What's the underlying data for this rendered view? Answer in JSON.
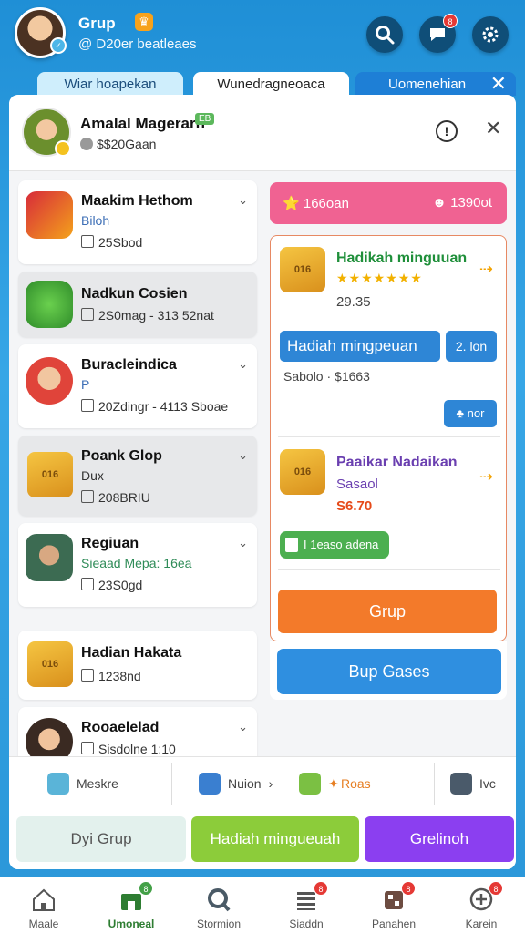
{
  "header": {
    "title": "Grup",
    "subtitle": "@ D20er beatleaes"
  },
  "tabs": [
    {
      "label": "Wiar hoapekan"
    },
    {
      "label": "Wunedragneoaca"
    },
    {
      "label": "Uomenehian"
    }
  ],
  "notification": {
    "name": "Amalal Magerarn",
    "tag": "EB",
    "sub": "$$20Gaan"
  },
  "list": [
    {
      "title": "Maakim Hethom",
      "sub1": "Biloh",
      "sub2": "25Sbod"
    },
    {
      "title": "Nadkun Cosien",
      "sub2": "2S0mag - 313 52nat"
    },
    {
      "title": "Buracleindica",
      "sub1": "P",
      "sub2": "20Zdingr - 4113 Sboae"
    },
    {
      "title": "Poank Glop",
      "sub1": "Dux",
      "sub2": "208BRIU",
      "chest": "016"
    },
    {
      "title": "Regiuan",
      "sub1": "Sieaad Mepa: 16ea",
      "sub2": "23S0gd"
    },
    {
      "title": "Hadian Hakata",
      "sub2": "1238nd",
      "chest": "016"
    },
    {
      "title": "Rooaelelad",
      "sub2": "Sisdolne 1:10"
    }
  ],
  "right": {
    "pink_left": "166oan",
    "pink_right": "1390ot",
    "reward1": {
      "title": "Hadikah minguuan",
      "stars": "★★★★★★★",
      "value": "29.35",
      "chest": "016"
    },
    "btn_hadiah": "Hadiah mingpeuan",
    "btn_small": "2. lon",
    "sale": "Sabolo · $1663",
    "btn_small2": "nor",
    "reward2": {
      "title": "Paaikar Nadaikan",
      "sub": "Sasaol",
      "price": "S6.70",
      "chest": "016"
    },
    "btn_green": "I 1easo adena",
    "btn_grup": "Grup",
    "btn_bup": "Bup Gases"
  },
  "quick": [
    {
      "label": "Meskre"
    },
    {
      "label": "Nuion"
    },
    {
      "label": "Roas"
    },
    {
      "label": "Ivc"
    }
  ],
  "actions": [
    {
      "label": "Dyi Grup"
    },
    {
      "label": "Hadiah mingueuah"
    },
    {
      "label": "Grelinoh"
    }
  ],
  "nav": [
    {
      "label": "Maale",
      "icon": "home-icon"
    },
    {
      "label": "Umoneal",
      "icon": "shop-icon",
      "badge": "8"
    },
    {
      "label": "Stormion",
      "icon": "search-icon"
    },
    {
      "label": "Siaddn",
      "icon": "list-icon",
      "badge": "8"
    },
    {
      "label": "Panahen",
      "icon": "box-icon",
      "badge": "8"
    },
    {
      "label": "Karein",
      "icon": "profile-icon",
      "badge": "8"
    }
  ],
  "colors": {
    "accent": "#2f8fe0",
    "orange": "#f37a2a",
    "pink": "#f06292",
    "green": "#8ccc3a",
    "purple": "#8b3ff0"
  }
}
